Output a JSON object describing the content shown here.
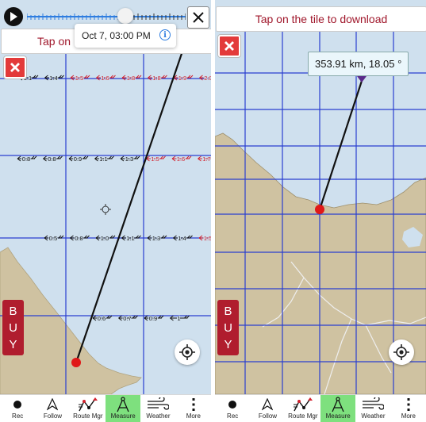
{
  "left_panel": {
    "timeline": {
      "tooltip_time": "Oct 7, 03:00 PM"
    },
    "banner": {
      "text_visible": "Tap on"
    },
    "buy": {
      "letters": [
        "B",
        "U",
        "Y"
      ]
    },
    "wind_rows": [
      {
        "values": [
          "1.1",
          "1.4",
          "1.5",
          "1.6",
          "1.8",
          "1.8",
          "1.9",
          "2.0"
        ]
      },
      {
        "values": [
          "0.8",
          "0.8",
          "0.9",
          "1.1",
          "1.3",
          "1.5",
          "1.6",
          "1.7",
          "1.8"
        ]
      },
      {
        "values": [
          "0.5",
          "0.8",
          "1.0",
          "1.1",
          "1.3",
          "1.4",
          "1.5"
        ]
      },
      {
        "values": [
          "0.6",
          "0.7",
          "0.9",
          "1"
        ]
      }
    ]
  },
  "right_panel": {
    "banner": {
      "text": "Tap on the tile to download"
    },
    "measurement": {
      "label": "353.91 km, 18.05 °"
    }
  },
  "toolbar": [
    {
      "key": "rec",
      "label": "Rec",
      "icon": "record-dot-icon",
      "active": false
    },
    {
      "key": "follow",
      "label": "Follow",
      "icon": "navigation-arrow-icon",
      "active": false
    },
    {
      "key": "route",
      "label": "Route Mgr",
      "icon": "route-icon",
      "active": false
    },
    {
      "key": "measure",
      "label": "Measure",
      "icon": "compass-divider-icon",
      "active": true
    },
    {
      "key": "weather",
      "label": "Weather",
      "icon": "wind-icon",
      "active": false
    },
    {
      "key": "more",
      "label": "More",
      "icon": "more-vertical-icon",
      "active": false
    }
  ],
  "colors": {
    "sea": "#cfe0ee",
    "land": "#cfc2a1",
    "grid": "#2a3fd0",
    "banner_text": "#a0172b",
    "buy_bg": "#b01d2e",
    "close_red": "#e33a3a",
    "active_tool": "#7ee07e",
    "timeline": "#2e7de0"
  }
}
